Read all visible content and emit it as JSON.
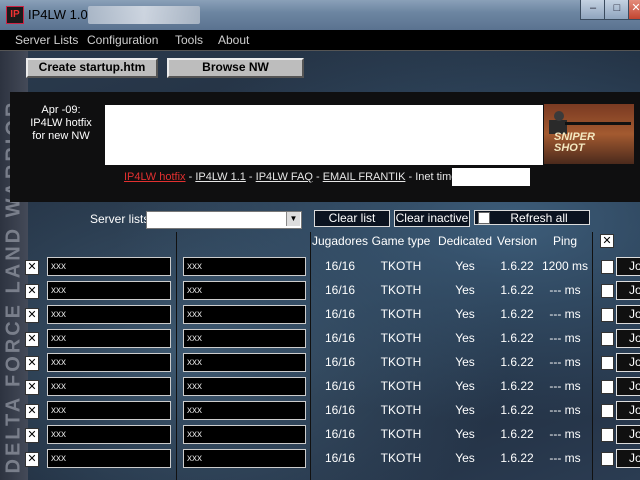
{
  "window": {
    "title": "IP4LW 1.0",
    "min_label": "–",
    "max_label": "□",
    "close_label": "✕",
    "app_icon": "IP"
  },
  "menu": [
    "Server Lists",
    "Configuration",
    "Tools",
    "About"
  ],
  "toolbar": {
    "startup_label": "Create startup.htm",
    "browse_label": "Browse NW"
  },
  "news": {
    "date_text": "Apr -09:\nIP4LW hotfix\nfor new NW",
    "banner_text": "SNIPER\nSHOT",
    "links": [
      "IP4LW hotfix",
      "IP4LW 1.1",
      "IP4LW FAQ",
      "EMAIL FRANTIK",
      "Inet time:"
    ],
    "separator": " - "
  },
  "side_watermark": "DELTA FORCE LAND WARRIOR",
  "controls": {
    "server_lists_label": "Server lists:",
    "server_lists_value": "",
    "clear_list": "Clear list",
    "clear_inactive": "Clear inactive",
    "refresh_all": "Refresh all"
  },
  "table": {
    "headers": [
      "Jugadores",
      "Game type",
      "Dedicated",
      "Version",
      "Ping"
    ],
    "rows": [
      {
        "checked": "✕",
        "name": "xxx",
        "ip": "xxx",
        "players": "16/16",
        "type": "TKOTH",
        "dedicated": "Yes",
        "version": "1.6.22",
        "ping": "1200 ms",
        "join": "Jo"
      },
      {
        "checked": "✕",
        "name": "xxx",
        "ip": "xxx",
        "players": "16/16",
        "type": "TKOTH",
        "dedicated": "Yes",
        "version": "1.6.22",
        "ping": "--- ms",
        "join": "Jo"
      },
      {
        "checked": "✕",
        "name": "xxx",
        "ip": "xxx",
        "players": "16/16",
        "type": "TKOTH",
        "dedicated": "Yes",
        "version": "1.6.22",
        "ping": "--- ms",
        "join": "Jo"
      },
      {
        "checked": "✕",
        "name": "xxx",
        "ip": "xxx",
        "players": "16/16",
        "type": "TKOTH",
        "dedicated": "Yes",
        "version": "1.6.22",
        "ping": "--- ms",
        "join": "Jo"
      },
      {
        "checked": "✕",
        "name": "xxx",
        "ip": "xxx",
        "players": "16/16",
        "type": "TKOTH",
        "dedicated": "Yes",
        "version": "1.6.22",
        "ping": "--- ms",
        "join": "Jo"
      },
      {
        "checked": "✕",
        "name": "xxx",
        "ip": "xxx",
        "players": "16/16",
        "type": "TKOTH",
        "dedicated": "Yes",
        "version": "1.6.22",
        "ping": "--- ms",
        "join": "Jo"
      },
      {
        "checked": "✕",
        "name": "xxx",
        "ip": "xxx",
        "players": "16/16",
        "type": "TKOTH",
        "dedicated": "Yes",
        "version": "1.6.22",
        "ping": "--- ms",
        "join": "Jo"
      },
      {
        "checked": "✕",
        "name": "xxx",
        "ip": "xxx",
        "players": "16/16",
        "type": "TKOTH",
        "dedicated": "Yes",
        "version": "1.6.22",
        "ping": "--- ms",
        "join": "Jo"
      },
      {
        "checked": "✕",
        "name": "xxx",
        "ip": "xxx",
        "players": "16/16",
        "type": "TKOTH",
        "dedicated": "Yes",
        "version": "1.6.22",
        "ping": "--- ms",
        "join": "Jo"
      }
    ],
    "header_checkbox": "✕"
  }
}
